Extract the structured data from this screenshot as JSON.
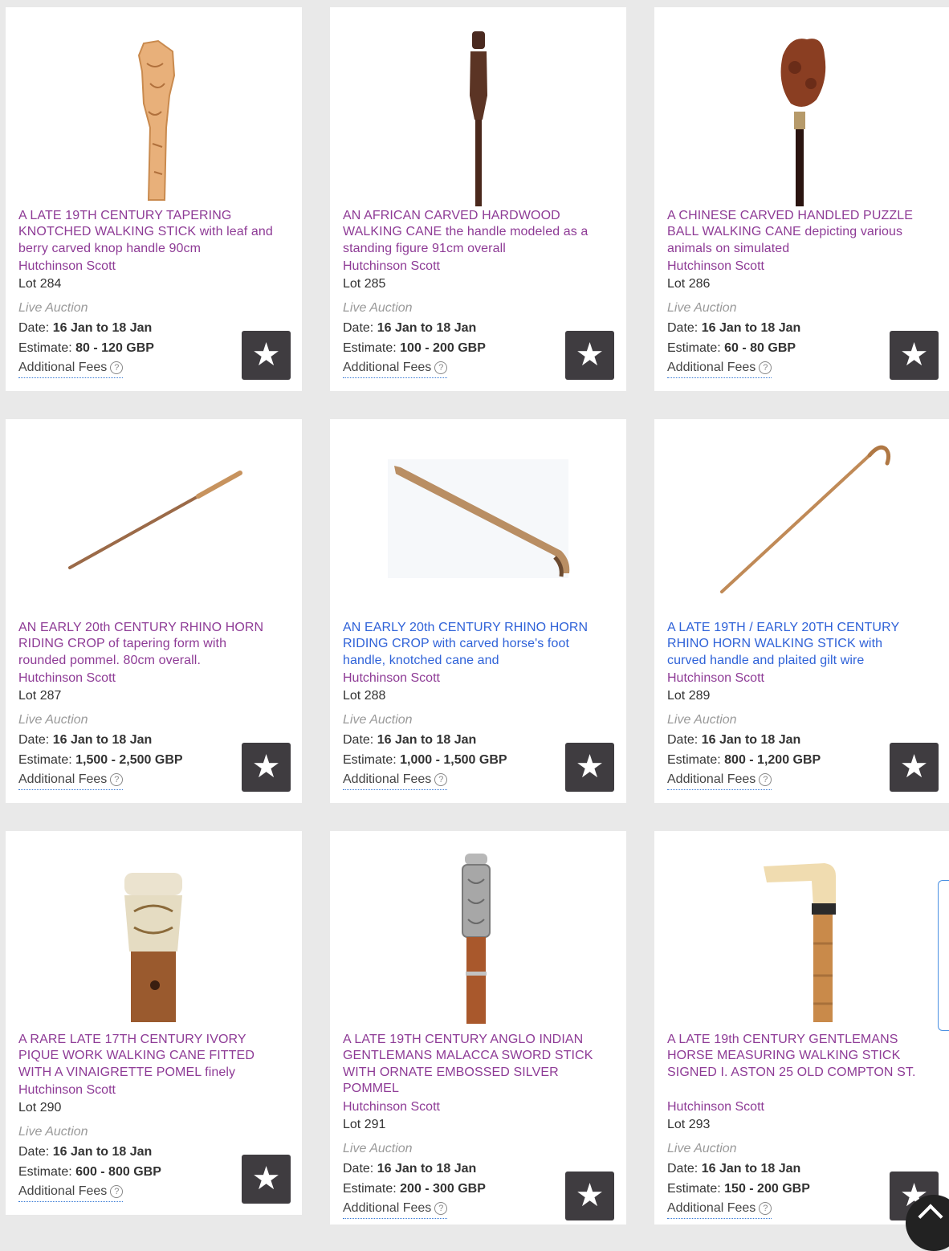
{
  "lots": [
    {
      "title": "A LATE 19TH CENTURY TAPERING KNOTCHED WALKING STICK with leaf and berry carved knop handle 90cm",
      "house": "Hutchinson Scott",
      "lot": "Lot 284",
      "type": "Live Auction",
      "date_label": "Date:",
      "date": "16 Jan to 18 Jan",
      "estimate_label": "Estimate:",
      "estimate": "80 - 120 GBP",
      "fees": "Additional Fees",
      "image": "carved-knop-stick"
    },
    {
      "title": "AN AFRICAN CARVED HARDWOOD WALKING CANE the handle modeled as a standing figure 91cm overall",
      "house": "Hutchinson Scott",
      "lot": "Lot 285",
      "type": "Live Auction",
      "date_label": "Date:",
      "date": "16 Jan to 18 Jan",
      "estimate_label": "Estimate:",
      "estimate": "100 - 200 GBP",
      "fees": "Additional Fees",
      "image": "african-figure-cane"
    },
    {
      "title": "A CHINESE CARVED HANDLED PUZZLE BALL WALKING CANE depicting various animals on simulated",
      "house": "Hutchinson Scott",
      "lot": "Lot 286",
      "type": "Live Auction",
      "date_label": "Date:",
      "date": "16 Jan to 18 Jan",
      "estimate_label": "Estimate:",
      "estimate": "60 - 80 GBP",
      "fees": "Additional Fees",
      "image": "puzzle-ball-cane"
    },
    {
      "title": "AN EARLY 20th CENTURY RHINO HORN RIDING CROP of tapering form with rounded pommel. 80cm overall.",
      "house": "Hutchinson Scott",
      "lot": "Lot 287",
      "type": "Live Auction",
      "date_label": "Date:",
      "date": "16 Jan to 18 Jan",
      "estimate_label": "Estimate:",
      "estimate": "1,500 - 2,500 GBP",
      "fees": "Additional Fees",
      "image": "riding-crop"
    },
    {
      "title": "AN EARLY 20th CENTURY RHINO HORN RIDING CROP with carved horse's foot handle, knotched cane and",
      "house": "Hutchinson Scott",
      "lot": "Lot 288",
      "type": "Live Auction",
      "date_label": "Date:",
      "date": "16 Jan to 18 Jan",
      "estimate_label": "Estimate:",
      "estimate": "1,000 - 1,500 GBP",
      "fees": "Additional Fees",
      "image": "horse-foot-crop"
    },
    {
      "title": "A LATE 19TH / EARLY 20TH CENTURY RHINO HORN WALKING STICK with curved handle and plaited gilt wire",
      "house": "Hutchinson Scott",
      "lot": "Lot 289",
      "type": "Live Auction",
      "date_label": "Date:",
      "date": "16 Jan to 18 Jan",
      "estimate_label": "Estimate:",
      "estimate": "800 - 1,200 GBP",
      "fees": "Additional Fees",
      "image": "crook-stick"
    },
    {
      "title": "A RARE LATE 17TH CENTURY IVORY PIQUE WORK WALKING CANE FITTED WITH A VINAIGRETTE POMEL finely",
      "house": "Hutchinson Scott",
      "lot": "Lot 290",
      "type": "Live Auction",
      "date_label": "Date:",
      "date": "16 Jan to 18 Jan",
      "estimate_label": "Estimate:",
      "estimate": "600 - 800 GBP",
      "fees": "Additional Fees",
      "image": "ivory-pommel-cane"
    },
    {
      "title": "A LATE 19TH CENTURY ANGLO INDIAN GENTLEMANS MALACCA SWORD STICK WITH ORNATE EMBOSSED SILVER POMMEL",
      "house": "Hutchinson Scott",
      "lot": "Lot 291",
      "type": "Live Auction",
      "date_label": "Date:",
      "date": "16 Jan to 18 Jan",
      "estimate_label": "Estimate:",
      "estimate": "200 - 300 GBP",
      "fees": "Additional Fees",
      "image": "silver-pommel-sword-stick"
    },
    {
      "title": "A LATE 19th CENTURY GENTLEMANS HORSE MEASURING WALKING STICK SIGNED I. ASTON 25 OLD COMPTON ST.",
      "house": "Hutchinson Scott",
      "lot": "Lot 293",
      "type": "Live Auction",
      "date_label": "Date:",
      "date": "16 Jan to 18 Jan",
      "estimate_label": "Estimate:",
      "estimate": "150 - 200 GBP",
      "fees": "Additional Fees",
      "image": "horse-measuring-stick"
    }
  ],
  "help_icon": "?",
  "watch_icon": "★",
  "colors": {
    "title": "#8e3b96",
    "title_visited": "#2f62d8",
    "button": "#3f3c40",
    "background": "#e9e9e9"
  }
}
